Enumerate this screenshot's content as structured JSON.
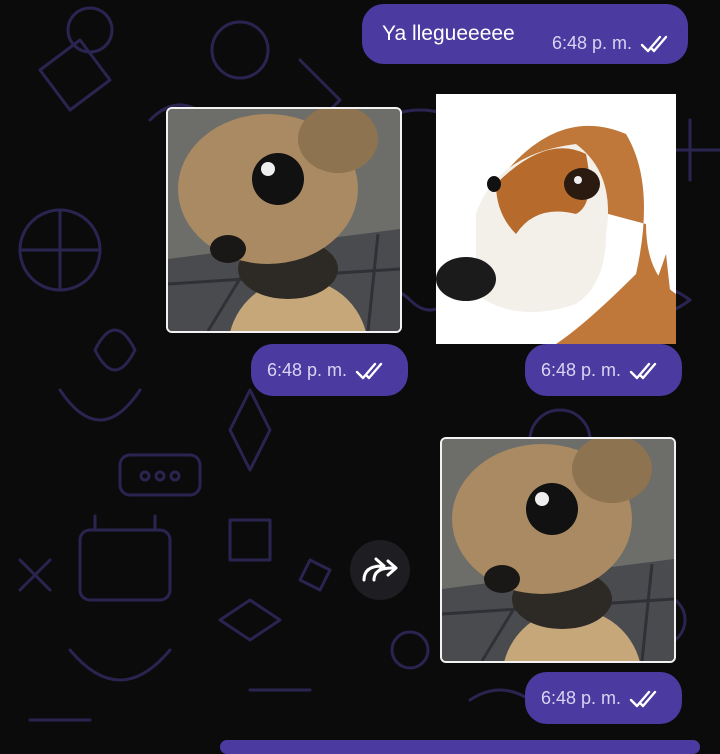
{
  "messages": [
    {
      "text": "Ya llegueeeee",
      "time": "6:48 p. m."
    },
    {
      "time": "6:48 p. m."
    },
    {
      "time": "6:48 p. m."
    },
    {
      "time": "6:48 p. m."
    }
  ],
  "icons": {
    "read_status": "double-check-icon",
    "forward": "forward-arrow-icon"
  },
  "colors": {
    "background": "#0b0b0c",
    "wallpaper_doodle": "#2a2450",
    "bubble": "#4b3aa0",
    "time_text": "#d9d4f2"
  }
}
